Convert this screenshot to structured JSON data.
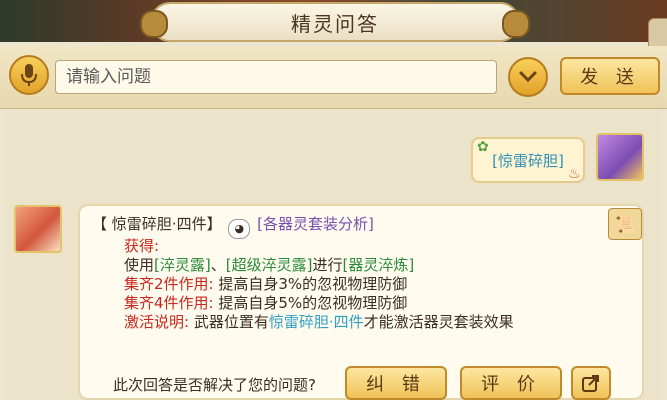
{
  "window": {
    "title": "精灵问答"
  },
  "search": {
    "placeholder": "请输入问题",
    "value": ""
  },
  "toolbar": {
    "send_label": "发 送"
  },
  "user_message": {
    "text": "[惊雷碎胆]"
  },
  "answer": {
    "header": {
      "bracket_open": "【",
      "title": "惊雷碎胆·四件】",
      "link": "[各器灵套装分析]"
    },
    "obtain_label": "获得:",
    "obtain_line": {
      "prefix": "使用",
      "item1": "[淬灵露]",
      "sep": "、",
      "item2": "[超级淬灵露]",
      "mid": "进行",
      "item3": "[器灵淬炼]"
    },
    "set2": {
      "label": "集齐2件作用:",
      "effect": "提高自身3%的忽视物理防御"
    },
    "set4": {
      "label": "集齐4件作用:",
      "effect": "提高自身5%的忽视物理防御"
    },
    "activate": {
      "label": "激活说明:",
      "prefix": "武器位置有",
      "item1": "惊雷碎胆·",
      "item2": "四件",
      "suffix": "才能激活器灵套装效果"
    }
  },
  "feedback": {
    "question": "此次回答是否解决了您的问题?",
    "correct_label": "纠 错",
    "rate_label": "评 价"
  },
  "colors": {
    "link": "#2f9fc2",
    "red": "#c8281e",
    "green": "#2a8a3a",
    "gold": "#f0c258"
  },
  "icons": [
    "mic-icon",
    "chevron-down-icon",
    "share-icon",
    "scroll-icon",
    "pet-icon",
    "flower-icon",
    "flame-icon"
  ]
}
